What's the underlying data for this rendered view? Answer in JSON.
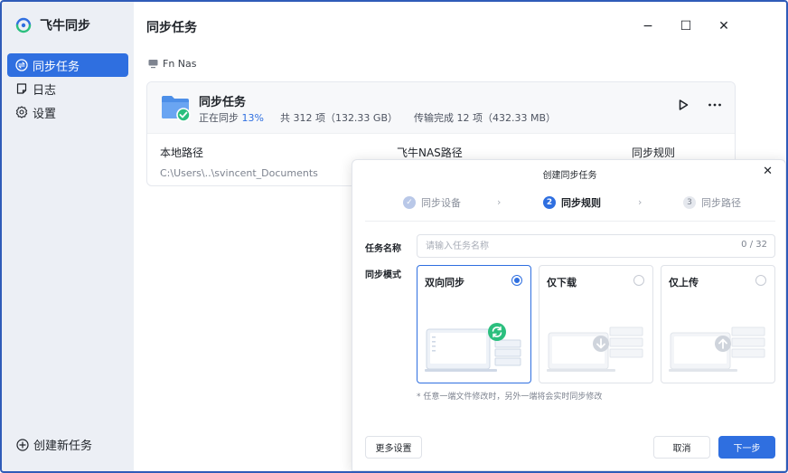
{
  "app": {
    "name": "飞牛同步"
  },
  "sidebar": {
    "items": [
      {
        "label": "同步任务",
        "icon": "sync-circle-icon",
        "active": true
      },
      {
        "label": "日志",
        "icon": "log-icon",
        "active": false
      },
      {
        "label": "设置",
        "icon": "gear-icon",
        "active": false
      }
    ],
    "create_label": "创建新任务"
  },
  "main": {
    "title": "同步任务",
    "window_controls": [
      "−",
      "☐",
      "✕"
    ],
    "device": "Fn Nas",
    "task": {
      "name": "同步任务",
      "status_prefix": "正在同步",
      "status_pct": "13%",
      "total": "共 312 项（132.33 GB）",
      "transferred": "传输完成 12 项（432.33 MB）",
      "columns": [
        {
          "header": "本地路径",
          "value": "C:\\Users\\..\\svincent_Documents"
        },
        {
          "header": "飞牛NAS路径",
          "value": ""
        },
        {
          "header": "同步规则",
          "value": ""
        }
      ]
    }
  },
  "modal": {
    "title": "创建同步任务",
    "steps": [
      {
        "num": "✓",
        "label": "同步设备",
        "state": "done"
      },
      {
        "num": "2",
        "label": "同步规则",
        "state": "active"
      },
      {
        "num": "3",
        "label": "同步路径",
        "state": "todo"
      }
    ],
    "step_separator": "›",
    "name_label": "任务名称",
    "name_placeholder": "请输入任务名称",
    "name_counter": "0 / 32",
    "mode_label": "同步模式",
    "modes": [
      {
        "label": "双向同步",
        "selected": true
      },
      {
        "label": "仅下载",
        "selected": false
      },
      {
        "label": "仅上传",
        "selected": false
      }
    ],
    "hint": "* 任意一端文件修改时，另外一端将会实时同步修改",
    "more_label": "更多设置",
    "cancel_label": "取消",
    "next_label": "下一步"
  },
  "colors": {
    "accent": "#2f6fe0",
    "success": "#2bbf7e",
    "sidebar_bg": "#eceff5"
  }
}
